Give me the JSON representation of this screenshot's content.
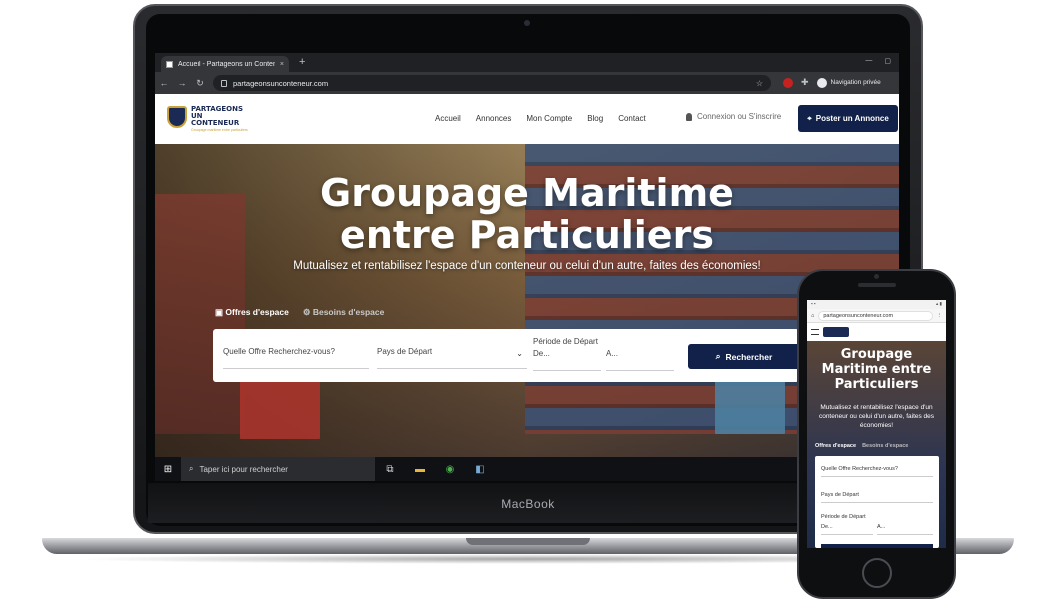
{
  "device": {
    "laptop_label": "MacBook"
  },
  "browser": {
    "tab_title": "Accueil - Partageons un Conteneur",
    "tab_close": "×",
    "new_tab": "+",
    "url": "partageonsunconteneur.com",
    "private_label": "Navigation privée",
    "window_controls": [
      "—",
      "▢"
    ]
  },
  "site": {
    "logo_line1": "PARTAGEONS",
    "logo_line2": "UN",
    "logo_line3": "CONTENEUR",
    "logo_tagline": "Groupage maritime entre particuliers",
    "nav": [
      "Accueil",
      "Annonces",
      "Mon Compte",
      "Blog",
      "Contact"
    ],
    "login": "Connexion ou S'inscrire",
    "post_button": "Poster un Annonce",
    "hero_title_line1": "Groupage Maritime",
    "hero_title_line2": "entre Particuliers",
    "hero_subtitle": "Mutualisez et rentabilisez l'espace d'un conteneur ou celui d'un autre, faites des économies!",
    "tab_offers": "Offres d'espace",
    "tab_needs": "Besoins d'espace",
    "search": {
      "field_query": "Quelle Offre Recherchez-vous?",
      "field_country": "Pays de Départ",
      "period_label": "Période de Départ",
      "from": "De...",
      "to": "A...",
      "button": "Rechercher"
    }
  },
  "taskbar": {
    "search_placeholder": "Taper ici pour rechercher"
  },
  "phone": {
    "url": "partageonsunconteneur.com",
    "hero_title": "Groupage Maritime entre Particuliers",
    "hero_subtitle": "Mutualisez et rentabilisez l'espace d'un conteneur ou celui d'un autre, faites des économies!",
    "tab_offers": "Offres d'espace",
    "tab_needs": "Besoins d'espace",
    "field_query": "Quelle Offre Recherchez-vous?",
    "field_country": "Pays de Départ",
    "period_label": "Période de Départ",
    "from": "De...",
    "to": "A..."
  },
  "colors": {
    "brand_navy": "#12214a",
    "accent_gold": "#c9a23a"
  }
}
